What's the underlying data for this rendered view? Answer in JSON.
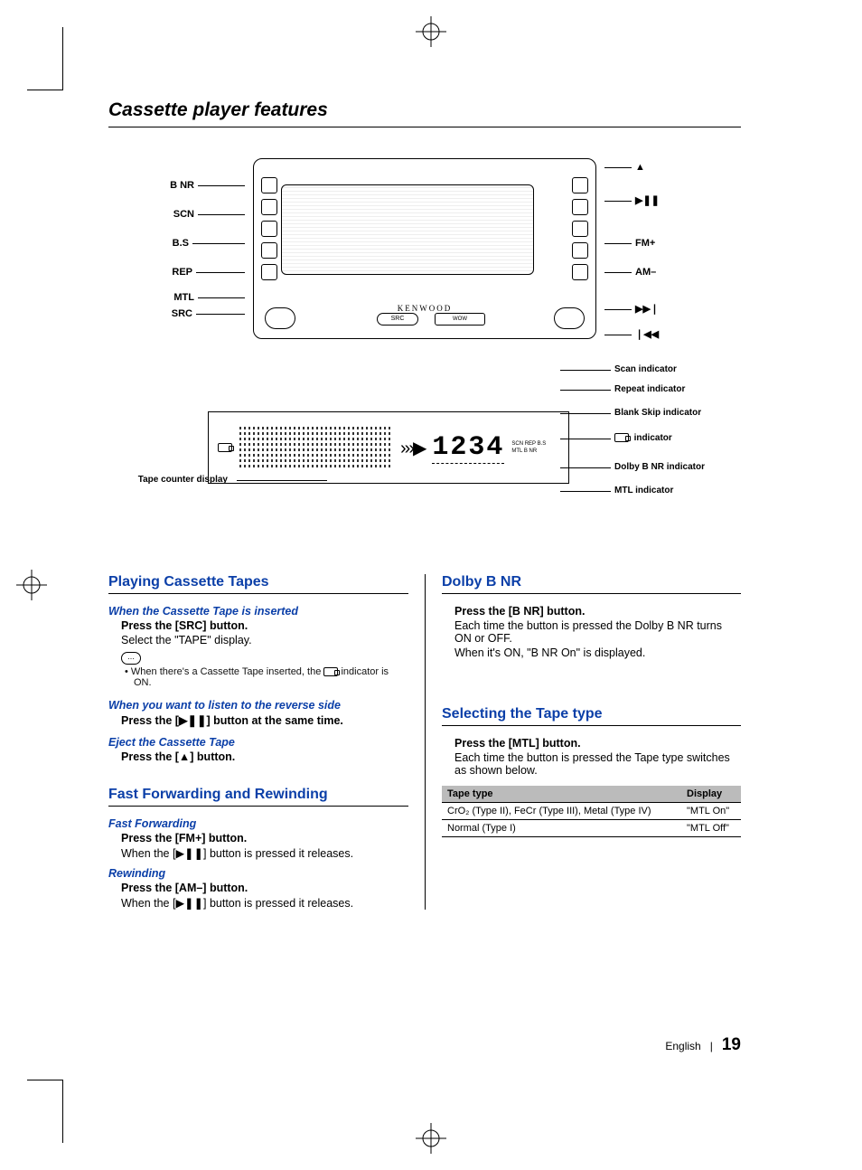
{
  "title": "Cassette player features",
  "diagram": {
    "left_callouts": [
      "B NR",
      "SCN",
      "B.S",
      "REP",
      "MTL",
      "SRC"
    ],
    "right_callouts": [
      "▲",
      "▶❚❚",
      "FM+",
      "AM–",
      "▶▶❘",
      "❘◀◀"
    ],
    "brand": "KENWOOD",
    "src_label": "SRC",
    "wow_label": "WOW",
    "lcd_digits": "1234",
    "lcd_status_top": "SCN  REP  B.S",
    "lcd_status_bot": "MTL  B NR",
    "tape_counter_label": "Tape counter display",
    "display_callouts": [
      "Scan indicator",
      "Repeat indicator",
      "Blank Skip indicator",
      "indicator",
      "Dolby B NR indicator",
      "MTL indicator"
    ]
  },
  "sections": {
    "playing": {
      "heading": "Playing Cassette Tapes",
      "sub1": "When the Cassette Tape is inserted",
      "sub1_step": "Press the [SRC] button.",
      "sub1_body": "Select the \"TAPE\" display.",
      "note1": "When there's a Cassette Tape inserted, the ",
      "note1_tail": " indicator is ON.",
      "sub2": "When you want to listen to the reverse side",
      "sub2_step": "Press the [▶❚❚] button at the same time.",
      "sub3": "Eject the Cassette Tape",
      "sub3_step": "Press the [▲] button."
    },
    "ff": {
      "heading": "Fast Forwarding and Rewinding",
      "sub1": "Fast Forwarding",
      "sub1_step": "Press the [FM+] button.",
      "sub1_body": "When the [▶❚❚] button is pressed it releases.",
      "sub2": "Rewinding",
      "sub2_step": "Press the [AM–] button.",
      "sub2_body": "When the [▶❚❚] button is pressed it releases."
    },
    "dolby": {
      "heading": "Dolby B NR",
      "step": "Press the [B NR] button.",
      "body1": "Each time the button is pressed the Dolby B NR turns ON or OFF.",
      "body2": "When it's ON, \"B NR On\" is displayed."
    },
    "tapetype": {
      "heading": "Selecting the Tape type",
      "step": "Press the [MTL] button.",
      "body": "Each time the button is pressed the Tape type switches as shown below.",
      "th1": "Tape type",
      "th2": "Display",
      "r1c1": "CrO₂ (Type II), FeCr (Type III), Metal (Type IV)",
      "r1c2": "\"MTL On\"",
      "r2c1": "Normal (Type I)",
      "r2c2": "\"MTL Off\""
    }
  },
  "footer": {
    "lang": "English",
    "page": "19"
  }
}
